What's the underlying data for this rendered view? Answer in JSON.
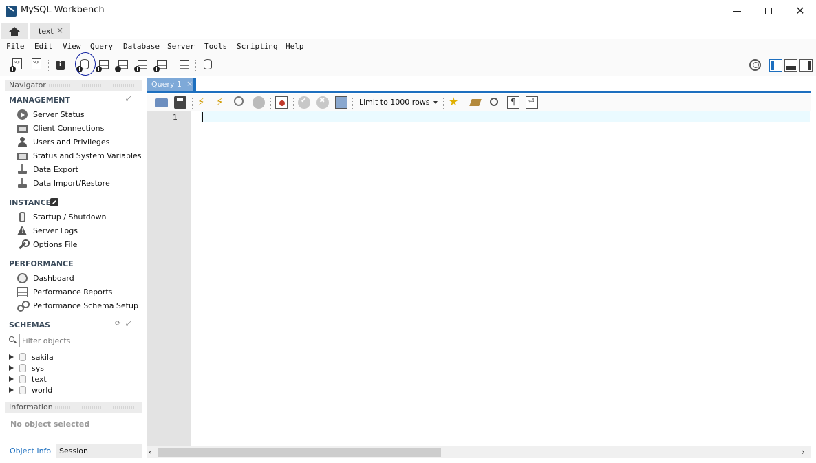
{
  "window": {
    "title": "MySQL Workbench",
    "close_glyph": "✕"
  },
  "tabs": {
    "connection_tab": {
      "label": "text",
      "close": "×"
    }
  },
  "menu": {
    "items": [
      "File",
      "Edit",
      "View",
      "Query",
      "Database",
      "Server",
      "Tools",
      "Scripting",
      "Help"
    ]
  },
  "navigator": {
    "header": "Navigator",
    "management": {
      "title": "MANAGEMENT",
      "items": [
        "Server Status",
        "Client Connections",
        "Users and Privileges",
        "Status and System Variables",
        "Data Export",
        "Data Import/Restore"
      ]
    },
    "instance": {
      "title": "INSTANCE",
      "items": [
        "Startup / Shutdown",
        "Server Logs",
        "Options File"
      ]
    },
    "performance": {
      "title": "PERFORMANCE",
      "items": [
        "Dashboard",
        "Performance Reports",
        "Performance Schema Setup"
      ]
    },
    "schemas": {
      "title": "SCHEMAS",
      "filter_placeholder": "Filter objects",
      "items": [
        "sakila",
        "sys",
        "text",
        "world"
      ]
    }
  },
  "information": {
    "header": "Information",
    "no_object": "No object selected",
    "tabs": [
      "Object Info",
      "Session"
    ]
  },
  "editor": {
    "tab_label": "Query 1",
    "tab_close": "×",
    "limit_label": "Limit to 1000 rows",
    "line_numbers": [
      "1"
    ]
  },
  "scrollbar": {
    "left_arrow": "‹",
    "right_arrow": "›"
  },
  "colors": {
    "accent": "#1d6fbf",
    "query_tab": "#7ea9d8",
    "gutter": "#e3e3e3",
    "current_line": "#eafaff",
    "annotation_circle": "#1020a0"
  }
}
